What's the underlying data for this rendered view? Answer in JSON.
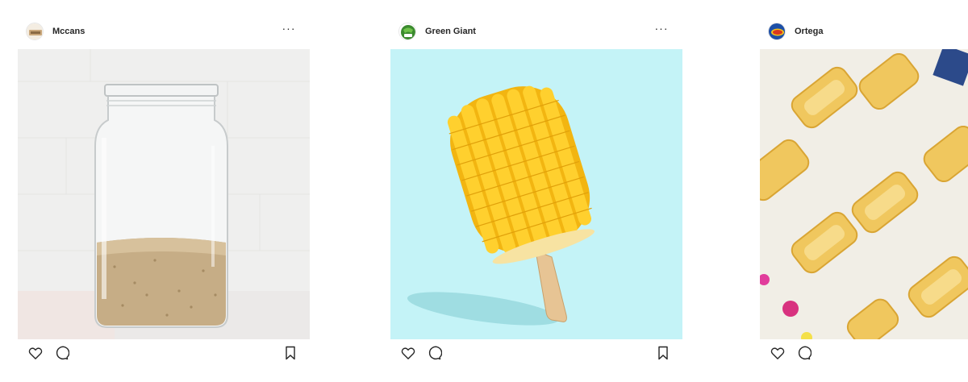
{
  "posts": [
    {
      "username": "Mccans",
      "more_label": "···",
      "avatar_icon": "mccans-logo-icon",
      "image": "glass-jar-with-grain",
      "colors": {
        "background": "#ededec",
        "avatar": "#c9a77b"
      }
    },
    {
      "username": "Green Giant",
      "more_label": "···",
      "avatar_icon": "green-giant-logo-icon",
      "image": "corn-cob-popsicle",
      "colors": {
        "background": "#c4f3f7",
        "avatar": "#3b8a2e"
      }
    },
    {
      "username": "Ortega",
      "more_label": "",
      "avatar_icon": "ortega-logo-icon",
      "image": "taco-shells-flatlay",
      "colors": {
        "background": "#f1eee6",
        "avatar": "#1d4fa6"
      }
    }
  ],
  "icons": {
    "like": "heart-icon",
    "comment": "comment-bubble-icon",
    "save": "bookmark-icon"
  }
}
